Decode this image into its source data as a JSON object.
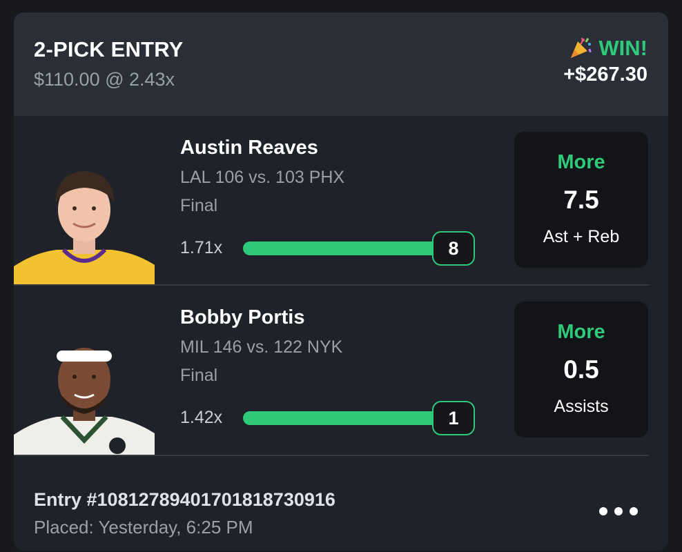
{
  "entry": {
    "title": "2-PICK ENTRY",
    "subtitle": "$110.00 @ 2.43x",
    "result": "WIN!",
    "payout": "+$267.30",
    "id": "Entry #1081278940170181873​0916",
    "placed": "Placed: Yesterday, 6:25 PM"
  },
  "picks": [
    {
      "player": "Austin Reaves",
      "game": "LAL 106 vs. 103 PHX",
      "status": "Final",
      "multiplier": "1.71x",
      "progress_value": "8",
      "progress_fraction": 1.0,
      "direction": "More",
      "line": "7.5",
      "stat": "Ast + Reb",
      "jersey_color": "#f2c230"
    },
    {
      "player": "Bobby Portis",
      "game": "MIL 146 vs. 122 NYK",
      "status": "Final",
      "multiplier": "1.42x",
      "progress_value": "1",
      "progress_fraction": 1.0,
      "direction": "More",
      "line": "0.5",
      "stat": "Assists",
      "jersey_color": "#f0eee8"
    }
  ],
  "icons": {
    "result": "party-popper-icon",
    "menu": "more-horizontal-icon"
  },
  "colors": {
    "accent_green": "#2fc97a",
    "card": "#1f2329",
    "header": "#2a2f37"
  }
}
